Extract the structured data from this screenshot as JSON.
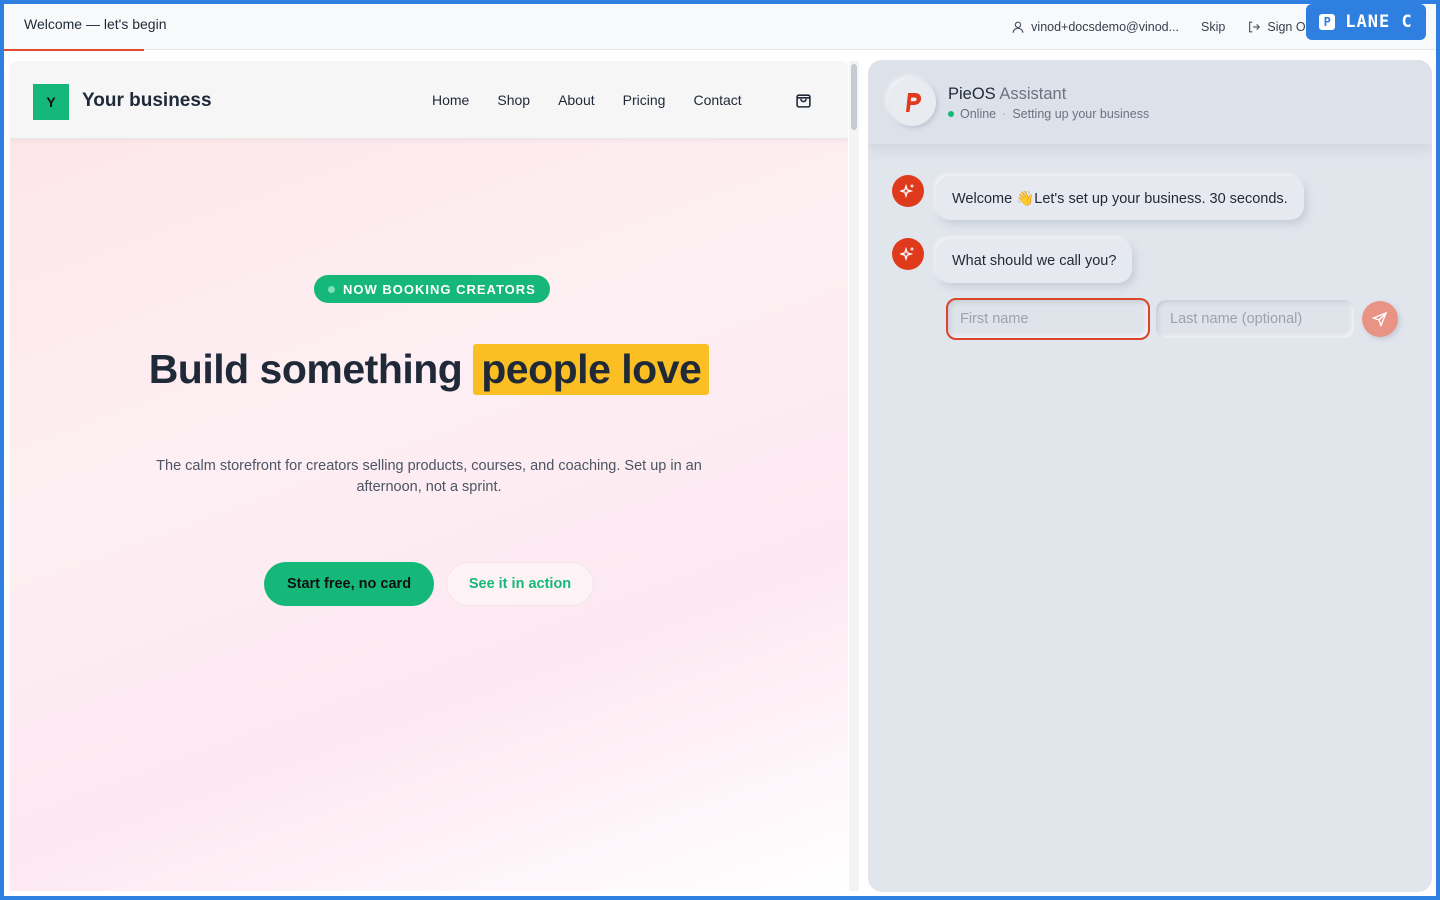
{
  "topbar": {
    "title": "Welcome — let's begin",
    "user_email": "vinod+docsdemo@vinod...",
    "skip_label": "Skip",
    "signout_label": "Sign Out"
  },
  "lane_badge": {
    "icon_letter": "P",
    "label": "LANE C"
  },
  "site": {
    "logo_letter": "Y",
    "brand_name": "Your business",
    "nav": [
      "Home",
      "Shop",
      "About",
      "Pricing",
      "Contact"
    ],
    "hero_badge": "NOW BOOKING CREATORS",
    "headline_plain": "Build something",
    "headline_highlight": "people love",
    "subtext": "The calm storefront for creators selling products, courses, and coaching. Set up in an afternoon, not a sprint.",
    "cta_primary": "Start free, no card",
    "cta_secondary": "See it in action"
  },
  "assistant": {
    "name": "PieOS",
    "name_suffix": "Assistant",
    "status": "Online",
    "status_detail": "Setting up your business",
    "messages": [
      "Welcome 👋Let's set up your business. 30 seconds.",
      "What should we call you?"
    ],
    "first_name_placeholder": "First name",
    "last_name_placeholder": "Last name (optional)"
  },
  "colors": {
    "accent_green": "#16b87a",
    "highlight_yellow": "#fbbf24",
    "brand_red": "#e03a1c",
    "frame_blue": "#2f7fe0"
  }
}
